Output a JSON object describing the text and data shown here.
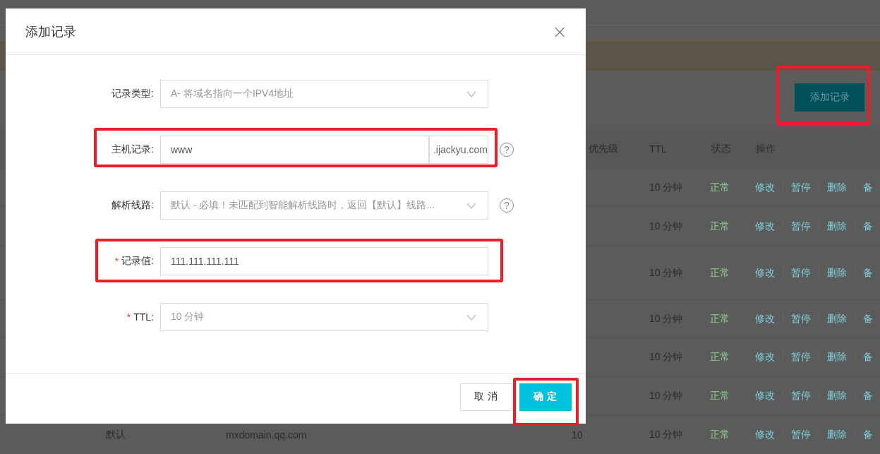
{
  "background": {
    "add_button": "添加记录",
    "table": {
      "header": {
        "priority": "优先级",
        "ttl": "TTL",
        "status": "状态",
        "actions": "操作"
      },
      "rows": [
        {
          "ttl": "10 分钟",
          "status": "正常",
          "actions": [
            "修改",
            "暂停",
            "删除",
            "备"
          ]
        },
        {
          "ttl": "10 分钟",
          "status": "正常",
          "actions": [
            "修改",
            "暂停",
            "删除",
            "备"
          ]
        },
        {
          "ttl": "10 分钟",
          "status": "正常",
          "actions": [
            "修改",
            "暂停",
            "删除",
            "备"
          ]
        },
        {
          "ttl": "10 分钟",
          "status": "正常",
          "actions": [
            "修改",
            "暂停",
            "删除",
            "备"
          ]
        },
        {
          "ttl": "10 分钟",
          "status": "正常",
          "actions": [
            "修改",
            "暂停",
            "删除",
            "备"
          ]
        },
        {
          "ttl": "10 分钟",
          "status": "正常",
          "actions": [
            "修改",
            "暂停",
            "删除",
            "备"
          ]
        },
        {
          "line": "默认",
          "value": "mxdomain.qq.com",
          "priority": "10",
          "ttl": "10 分钟",
          "status": "正常",
          "actions": [
            "修改",
            "暂停",
            "删除",
            "备"
          ]
        }
      ]
    }
  },
  "dialog": {
    "title": "添加记录",
    "close": "×",
    "required_mark": "*",
    "fields": [
      {
        "kind": "select",
        "label": "记录类型:",
        "required": false,
        "value": "A- 将域名指向一个IPV4地址"
      },
      {
        "kind": "suffix",
        "label": "主机记录:",
        "required": false,
        "value": "www",
        "suffix": ".ijackyu.com",
        "help": "?"
      },
      {
        "kind": "select",
        "label": "解析线路:",
        "required": false,
        "value": "默认 - 必填！未匹配到智能解析线路时，返回【默认】线路...",
        "help": "?"
      },
      {
        "kind": "input",
        "label": "记录值:",
        "required": true,
        "value": "111.111.111.111"
      },
      {
        "kind": "select",
        "label": "TTL:",
        "required": true,
        "value": "10 分钟"
      }
    ],
    "buttons": [
      {
        "label": "取 消",
        "primary": false
      },
      {
        "label": "确 定",
        "primary": true
      }
    ]
  }
}
